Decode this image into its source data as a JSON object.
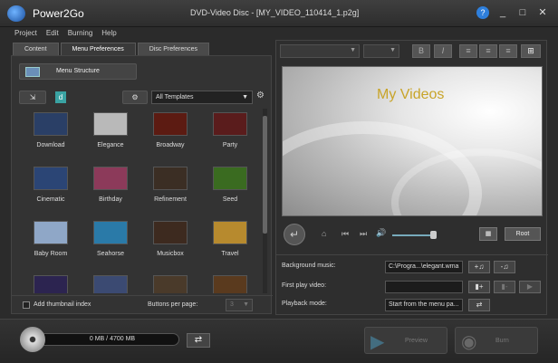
{
  "app": {
    "name": "Power2Go",
    "window_title": "DVD-Video Disc - [MY_VIDEO_110414_1.p2g]",
    "buttons": {
      "help": "?",
      "minimize": "_",
      "maximize": "□",
      "close": "✕"
    }
  },
  "menubar": [
    "Project",
    "Edit",
    "Burning",
    "Help"
  ],
  "tabs": [
    {
      "label": "Content",
      "active": false
    },
    {
      "label": "Menu Preferences",
      "active": true
    },
    {
      "label": "Disc Preferences",
      "active": false
    }
  ],
  "left": {
    "menu_structure_label": "Menu Structure",
    "import_glyph": "⇲",
    "badge": "d",
    "filter_glyph": "⚙",
    "template_filter": "All Templates",
    "settings_glyph": "⚙",
    "templates": [
      {
        "name": "Download",
        "color": "#2a3f66"
      },
      {
        "name": "Elegance",
        "color": "#b9b9b9"
      },
      {
        "name": "Broadway",
        "color": "#5c1b12"
      },
      {
        "name": "Party",
        "color": "#5a1c1c"
      },
      {
        "name": "Cinematic",
        "color": "#2b4575"
      },
      {
        "name": "Birthday",
        "color": "#8c3a5a"
      },
      {
        "name": "Refinement",
        "color": "#3b2e24"
      },
      {
        "name": "Seed",
        "color": "#3a6b20"
      },
      {
        "name": "Baby Room",
        "color": "#8fa7c7"
      },
      {
        "name": "Seahorse",
        "color": "#2a7aa8"
      },
      {
        "name": "Musicbox",
        "color": "#3d2a1f"
      },
      {
        "name": "Travel",
        "color": "#b78a2e"
      },
      {
        "name": "",
        "color": "#2c2450"
      },
      {
        "name": "",
        "color": "#3b4a72"
      },
      {
        "name": "",
        "color": "#4a3a2a"
      },
      {
        "name": "",
        "color": "#5a3a1e"
      }
    ],
    "add_thumbnail_index": "Add thumbnail index",
    "buttons_per_page_label": "Buttons per page:",
    "buttons_per_page_value": "3"
  },
  "right": {
    "format": {
      "bold": "B",
      "italic": "I",
      "align_left": "≡",
      "align_center": "≡",
      "align_right": "≡",
      "layout": "⊞"
    },
    "preview_title": "My Videos",
    "controls": {
      "back": "↵",
      "home": "⌂",
      "prev": "⏮",
      "next": "⏭",
      "volume": "🔊",
      "screen": "▦",
      "root": "Root"
    },
    "background_music_label": "Background music:",
    "background_music_value": "C:\\Progra...\\elegant.wma",
    "first_play_label": "First play video:",
    "first_play_value": "",
    "playback_mode_label": "Playback mode:",
    "playback_mode_value": "Start from the menu pa...",
    "btn_add_music": "+♫",
    "btn_music_settings": "-♫",
    "btn_add_video": "▮+",
    "btn_remove_video": "▮-",
    "btn_play_video": "▶",
    "btn_playback": "⇄"
  },
  "bottom": {
    "capacity": "0 MB / 4700 MB",
    "swap": "⇄",
    "preview_label": "Preview",
    "burn_label": "Burn",
    "preview_glyph": "▶",
    "burn_glyph": "◉"
  }
}
